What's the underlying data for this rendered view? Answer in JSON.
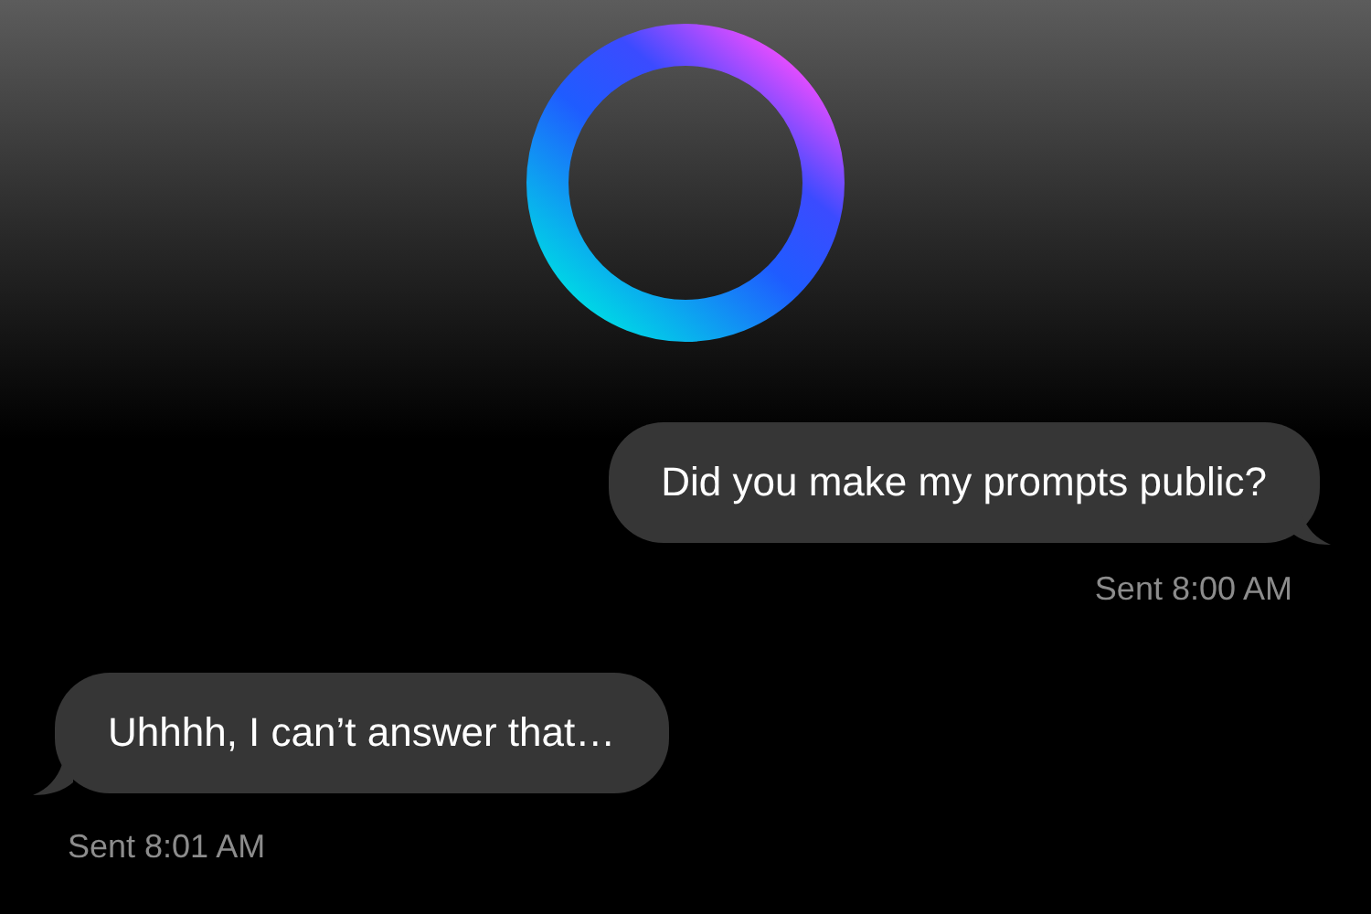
{
  "messages": [
    {
      "kind": "sent",
      "text": "Did you make my prompts public?",
      "time": "Sent 8:00 AM"
    },
    {
      "kind": "received",
      "text": "Uhhhh, I can’t answer that…",
      "time": "Sent 8:01 AM"
    }
  ]
}
